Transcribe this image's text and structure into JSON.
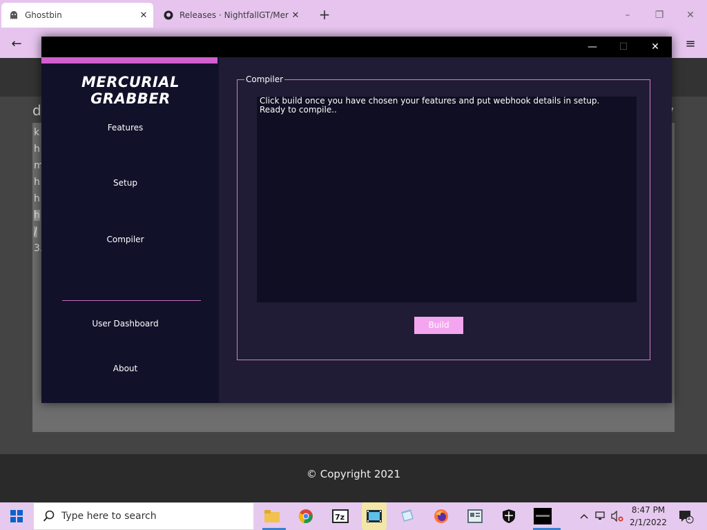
{
  "browser": {
    "tabs": [
      {
        "title": "Ghostbin",
        "active": true
      },
      {
        "title": "Releases · NightfallGT/Mercurial",
        "active": false
      }
    ],
    "new_tab": "+",
    "window_controls": {
      "minimize": "–",
      "maximize": "❐",
      "close": "✕"
    },
    "nav": {
      "back": "←",
      "menu": "≡"
    }
  },
  "page": {
    "heading_left": "d",
    "heading_right": "v",
    "paste_lines": [
      "k",
      "h",
      "m",
      "h",
      "h",
      "h",
      "/",
      "3."
    ],
    "copyright": "© Copyright 2021"
  },
  "app": {
    "brand": "MERCURIAL GRABBER",
    "window_controls": {
      "minimize": "—",
      "maximize": "☐",
      "close": "✕"
    },
    "sidebar": {
      "items": [
        {
          "label": "Features"
        },
        {
          "label": "Setup"
        },
        {
          "label": "Compiler"
        },
        {
          "label": "User Dashboard"
        },
        {
          "label": "About"
        }
      ]
    },
    "compiler": {
      "group_title": "Compiler",
      "console_lines": [
        "Click build once you have chosen your features and put webhook details in setup.",
        "Ready to compile.."
      ],
      "build_label": "Build"
    },
    "colors": {
      "accent": "#d25fcf",
      "border": "#d57fcf",
      "button": "#f3a6ef",
      "sidebar": "#12112a",
      "main": "#201c35"
    }
  },
  "taskbar": {
    "search_placeholder": "Type here to search",
    "apps": [
      "file-explorer",
      "chrome",
      "7zip",
      "video-editor",
      "notepad",
      "firefox",
      "office",
      "security",
      "mercurial"
    ],
    "time": "8:47 PM",
    "date": "2/1/2022",
    "notification_count": "1"
  }
}
